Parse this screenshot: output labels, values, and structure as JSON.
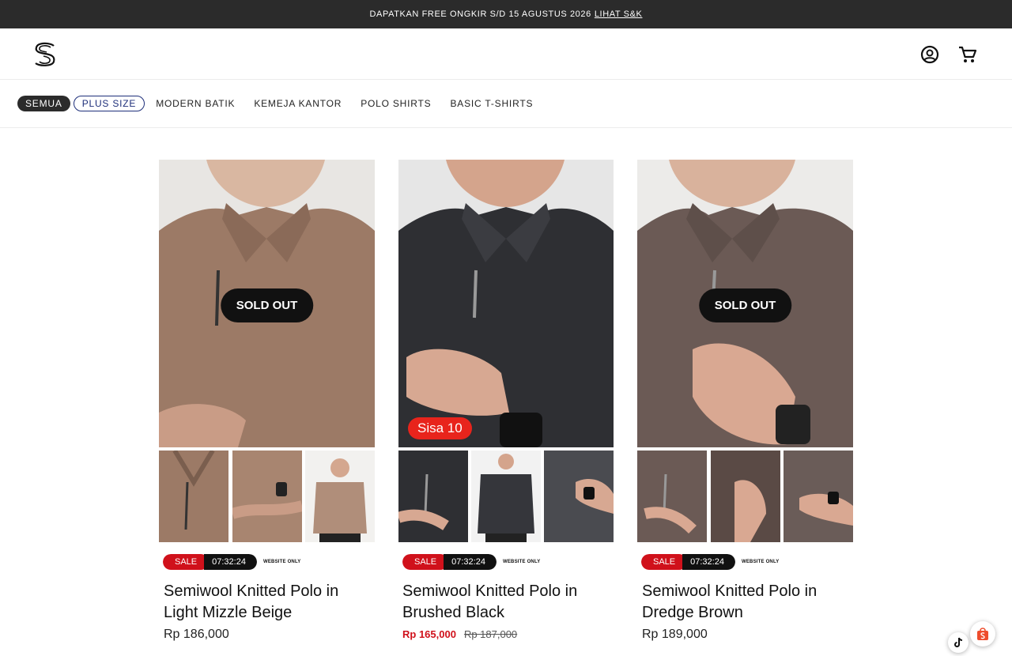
{
  "announcement": {
    "text": "DAPATKAN FREE ONGKIR S/D 15 AGUSTUS 2026",
    "link": "LIHAT S&K"
  },
  "header": {
    "logo_icon": "s-logo-icon",
    "account_icon": "account-circle-icon",
    "cart_icon": "cart-icon"
  },
  "nav": {
    "items": [
      {
        "label": "SEMUA"
      },
      {
        "label": "PLUS SIZE"
      },
      {
        "label": "MODERN BATIK"
      },
      {
        "label": "KEMEJA KANTOR"
      },
      {
        "label": "POLO SHIRTS"
      },
      {
        "label": "BASIC T-SHIRTS"
      }
    ]
  },
  "colors": {
    "sale_red": "#d0111b",
    "badge_red": "#e8241c",
    "dark": "#111111",
    "plus_size_blue": "#1e2f7a"
  },
  "products": [
    {
      "title": "Semiwool Knitted Polo in Light Mizzle Beige",
      "badge": "SOLD OUT",
      "sale_label": "SALE",
      "countdown": "07:32:24",
      "website_only": "WEBSITE ONLY",
      "price": "Rp 186,000",
      "shirt_color": "#9c7a66"
    },
    {
      "title": "Semiwool Knitted Polo in Brushed Black",
      "stock_badge": "Sisa 10",
      "sale_label": "SALE",
      "countdown": "07:32:24",
      "website_only": "WEBSITE ONLY",
      "price_sale": "Rp 165,000",
      "price_original": "Rp 187,000",
      "shirt_color": "#2e2f33"
    },
    {
      "title": "Semiwool Knitted Polo in Dredge Brown",
      "badge": "SOLD OUT",
      "sale_label": "SALE",
      "countdown": "07:32:24",
      "website_only": "WEBSITE ONLY",
      "price": "Rp 189,000",
      "shirt_color": "#6b5a55"
    }
  ]
}
